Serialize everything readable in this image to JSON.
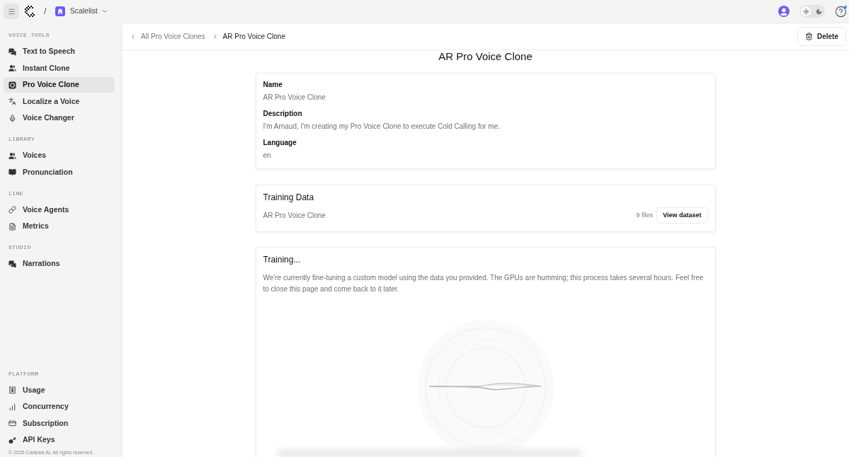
{
  "top_bar": {
    "separator": "/",
    "workspace": "Scalelist",
    "theme_toggle": [
      {
        "kind": "light",
        "selected": true
      },
      {
        "kind": "dark",
        "selected": false
      }
    ],
    "help": {
      "has_notification": true
    }
  },
  "sidebar": {
    "sections": [
      {
        "title": "VOICE TOOLS",
        "items": [
          {
            "label": "Text to Speech",
            "selected": false
          },
          {
            "label": "Instant Clone",
            "selected": false
          },
          {
            "label": "Pro Voice Clone",
            "selected": true
          },
          {
            "label": "Localize a Voice",
            "selected": false
          },
          {
            "label": "Voice Changer",
            "selected": false
          }
        ]
      },
      {
        "title": "LIBRARY",
        "items": [
          {
            "label": "Voices",
            "selected": false
          },
          {
            "label": "Pronunciation",
            "selected": false
          }
        ]
      },
      {
        "title": "LINE",
        "items": [
          {
            "label": "Voice Agents",
            "selected": false
          },
          {
            "label": "Metrics",
            "selected": false
          }
        ]
      },
      {
        "title": "STUDIO",
        "items": [
          {
            "label": "Narrations",
            "selected": false
          }
        ]
      },
      {
        "title": "PLATFORM",
        "items": [
          {
            "label": "Usage",
            "selected": false
          },
          {
            "label": "Concurrency",
            "selected": false
          },
          {
            "label": "Subscription",
            "selected": false
          },
          {
            "label": "API Keys",
            "selected": false
          }
        ]
      }
    ],
    "footer": "© 2025 Cartesia AI. All rights reserved."
  },
  "breadcrumbs": [
    {
      "label": "All Pro Voice Clones",
      "current": false
    },
    {
      "label": "AR Pro Voice Clone",
      "current": true
    }
  ],
  "delete_button": "Delete",
  "page_title": "AR Pro Voice Clone",
  "details": [
    {
      "label": "Name",
      "value": "AR Pro Voice Clone"
    },
    {
      "label": "Description",
      "value": "I'm Arnaud, I'm creating my Pro Voice Clone to execute Cold Calling for me."
    },
    {
      "label": "Language",
      "value": "en"
    }
  ],
  "training_data": {
    "title": "Training Data",
    "dataset": "AR Pro Voice Clone",
    "file_count": "9 files",
    "button": "View dataset"
  },
  "training": {
    "title": "Training...",
    "message": "We're currently fine-tuning a custom model using the data you provided. The GPUs are humming; this process takes several hours. Feel free to close this page and come back to it later."
  }
}
